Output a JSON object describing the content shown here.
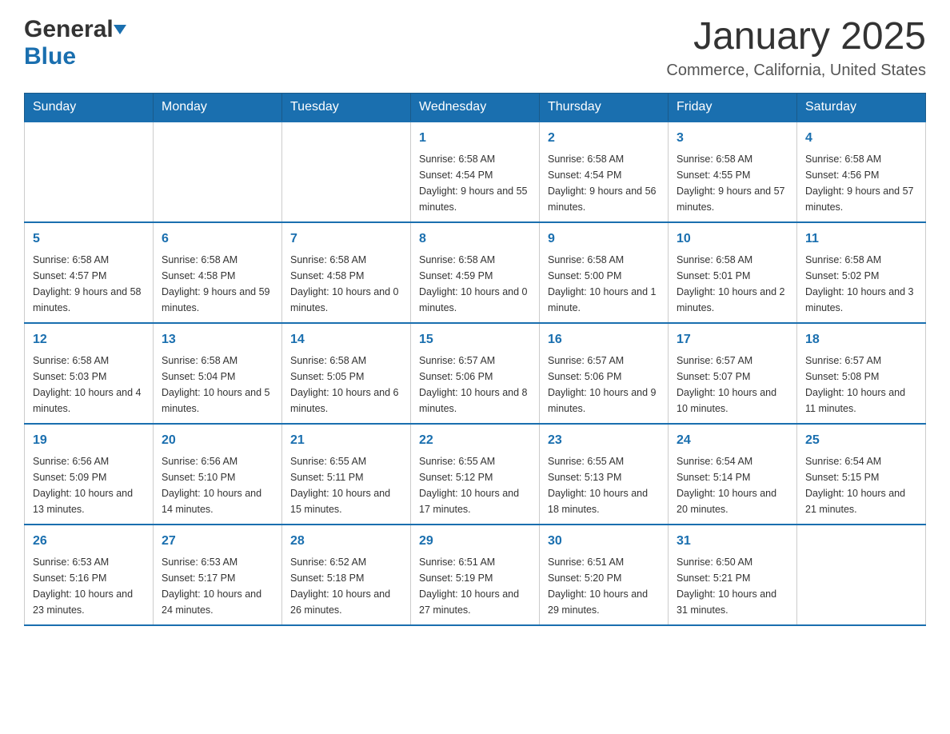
{
  "header": {
    "logo_general": "General",
    "logo_blue": "Blue",
    "month_title": "January 2025",
    "location": "Commerce, California, United States"
  },
  "days_of_week": [
    "Sunday",
    "Monday",
    "Tuesday",
    "Wednesday",
    "Thursday",
    "Friday",
    "Saturday"
  ],
  "weeks": [
    [
      {
        "day": "",
        "info": ""
      },
      {
        "day": "",
        "info": ""
      },
      {
        "day": "",
        "info": ""
      },
      {
        "day": "1",
        "info": "Sunrise: 6:58 AM\nSunset: 4:54 PM\nDaylight: 9 hours and 55 minutes."
      },
      {
        "day": "2",
        "info": "Sunrise: 6:58 AM\nSunset: 4:54 PM\nDaylight: 9 hours and 56 minutes."
      },
      {
        "day": "3",
        "info": "Sunrise: 6:58 AM\nSunset: 4:55 PM\nDaylight: 9 hours and 57 minutes."
      },
      {
        "day": "4",
        "info": "Sunrise: 6:58 AM\nSunset: 4:56 PM\nDaylight: 9 hours and 57 minutes."
      }
    ],
    [
      {
        "day": "5",
        "info": "Sunrise: 6:58 AM\nSunset: 4:57 PM\nDaylight: 9 hours and 58 minutes."
      },
      {
        "day": "6",
        "info": "Sunrise: 6:58 AM\nSunset: 4:58 PM\nDaylight: 9 hours and 59 minutes."
      },
      {
        "day": "7",
        "info": "Sunrise: 6:58 AM\nSunset: 4:58 PM\nDaylight: 10 hours and 0 minutes."
      },
      {
        "day": "8",
        "info": "Sunrise: 6:58 AM\nSunset: 4:59 PM\nDaylight: 10 hours and 0 minutes."
      },
      {
        "day": "9",
        "info": "Sunrise: 6:58 AM\nSunset: 5:00 PM\nDaylight: 10 hours and 1 minute."
      },
      {
        "day": "10",
        "info": "Sunrise: 6:58 AM\nSunset: 5:01 PM\nDaylight: 10 hours and 2 minutes."
      },
      {
        "day": "11",
        "info": "Sunrise: 6:58 AM\nSunset: 5:02 PM\nDaylight: 10 hours and 3 minutes."
      }
    ],
    [
      {
        "day": "12",
        "info": "Sunrise: 6:58 AM\nSunset: 5:03 PM\nDaylight: 10 hours and 4 minutes."
      },
      {
        "day": "13",
        "info": "Sunrise: 6:58 AM\nSunset: 5:04 PM\nDaylight: 10 hours and 5 minutes."
      },
      {
        "day": "14",
        "info": "Sunrise: 6:58 AM\nSunset: 5:05 PM\nDaylight: 10 hours and 6 minutes."
      },
      {
        "day": "15",
        "info": "Sunrise: 6:57 AM\nSunset: 5:06 PM\nDaylight: 10 hours and 8 minutes."
      },
      {
        "day": "16",
        "info": "Sunrise: 6:57 AM\nSunset: 5:06 PM\nDaylight: 10 hours and 9 minutes."
      },
      {
        "day": "17",
        "info": "Sunrise: 6:57 AM\nSunset: 5:07 PM\nDaylight: 10 hours and 10 minutes."
      },
      {
        "day": "18",
        "info": "Sunrise: 6:57 AM\nSunset: 5:08 PM\nDaylight: 10 hours and 11 minutes."
      }
    ],
    [
      {
        "day": "19",
        "info": "Sunrise: 6:56 AM\nSunset: 5:09 PM\nDaylight: 10 hours and 13 minutes."
      },
      {
        "day": "20",
        "info": "Sunrise: 6:56 AM\nSunset: 5:10 PM\nDaylight: 10 hours and 14 minutes."
      },
      {
        "day": "21",
        "info": "Sunrise: 6:55 AM\nSunset: 5:11 PM\nDaylight: 10 hours and 15 minutes."
      },
      {
        "day": "22",
        "info": "Sunrise: 6:55 AM\nSunset: 5:12 PM\nDaylight: 10 hours and 17 minutes."
      },
      {
        "day": "23",
        "info": "Sunrise: 6:55 AM\nSunset: 5:13 PM\nDaylight: 10 hours and 18 minutes."
      },
      {
        "day": "24",
        "info": "Sunrise: 6:54 AM\nSunset: 5:14 PM\nDaylight: 10 hours and 20 minutes."
      },
      {
        "day": "25",
        "info": "Sunrise: 6:54 AM\nSunset: 5:15 PM\nDaylight: 10 hours and 21 minutes."
      }
    ],
    [
      {
        "day": "26",
        "info": "Sunrise: 6:53 AM\nSunset: 5:16 PM\nDaylight: 10 hours and 23 minutes."
      },
      {
        "day": "27",
        "info": "Sunrise: 6:53 AM\nSunset: 5:17 PM\nDaylight: 10 hours and 24 minutes."
      },
      {
        "day": "28",
        "info": "Sunrise: 6:52 AM\nSunset: 5:18 PM\nDaylight: 10 hours and 26 minutes."
      },
      {
        "day": "29",
        "info": "Sunrise: 6:51 AM\nSunset: 5:19 PM\nDaylight: 10 hours and 27 minutes."
      },
      {
        "day": "30",
        "info": "Sunrise: 6:51 AM\nSunset: 5:20 PM\nDaylight: 10 hours and 29 minutes."
      },
      {
        "day": "31",
        "info": "Sunrise: 6:50 AM\nSunset: 5:21 PM\nDaylight: 10 hours and 31 minutes."
      },
      {
        "day": "",
        "info": ""
      }
    ]
  ]
}
